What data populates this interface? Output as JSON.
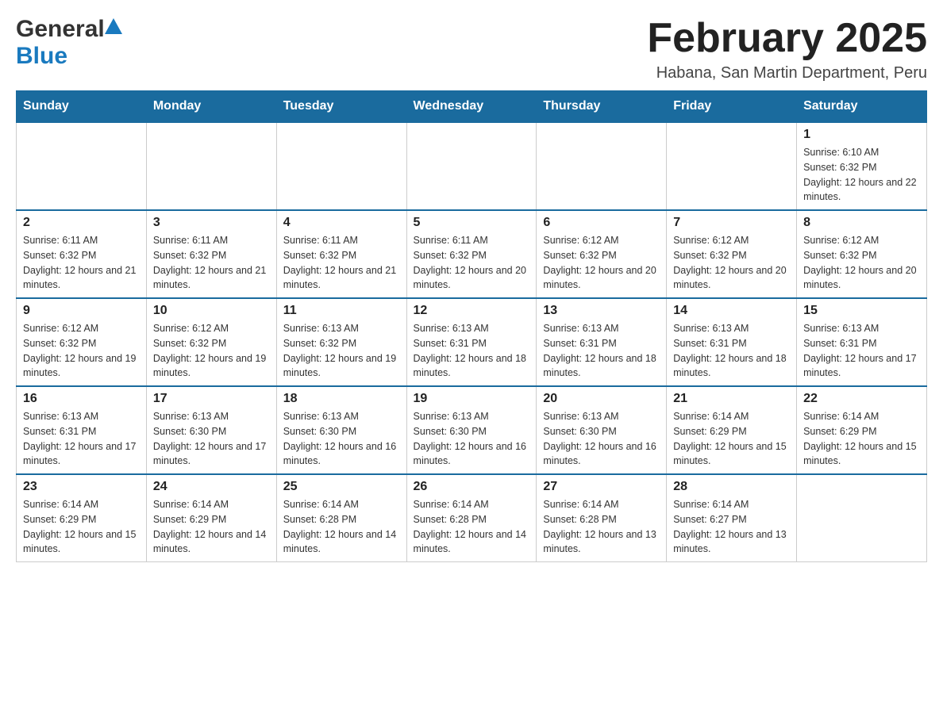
{
  "header": {
    "logo_general": "General",
    "logo_blue": "Blue",
    "month_year": "February 2025",
    "location": "Habana, San Martin Department, Peru"
  },
  "weekdays": [
    "Sunday",
    "Monday",
    "Tuesday",
    "Wednesday",
    "Thursday",
    "Friday",
    "Saturday"
  ],
  "weeks": [
    [
      {
        "day": "",
        "sunrise": "",
        "sunset": "",
        "daylight": ""
      },
      {
        "day": "",
        "sunrise": "",
        "sunset": "",
        "daylight": ""
      },
      {
        "day": "",
        "sunrise": "",
        "sunset": "",
        "daylight": ""
      },
      {
        "day": "",
        "sunrise": "",
        "sunset": "",
        "daylight": ""
      },
      {
        "day": "",
        "sunrise": "",
        "sunset": "",
        "daylight": ""
      },
      {
        "day": "",
        "sunrise": "",
        "sunset": "",
        "daylight": ""
      },
      {
        "day": "1",
        "sunrise": "Sunrise: 6:10 AM",
        "sunset": "Sunset: 6:32 PM",
        "daylight": "Daylight: 12 hours and 22 minutes."
      }
    ],
    [
      {
        "day": "2",
        "sunrise": "Sunrise: 6:11 AM",
        "sunset": "Sunset: 6:32 PM",
        "daylight": "Daylight: 12 hours and 21 minutes."
      },
      {
        "day": "3",
        "sunrise": "Sunrise: 6:11 AM",
        "sunset": "Sunset: 6:32 PM",
        "daylight": "Daylight: 12 hours and 21 minutes."
      },
      {
        "day": "4",
        "sunrise": "Sunrise: 6:11 AM",
        "sunset": "Sunset: 6:32 PM",
        "daylight": "Daylight: 12 hours and 21 minutes."
      },
      {
        "day": "5",
        "sunrise": "Sunrise: 6:11 AM",
        "sunset": "Sunset: 6:32 PM",
        "daylight": "Daylight: 12 hours and 20 minutes."
      },
      {
        "day": "6",
        "sunrise": "Sunrise: 6:12 AM",
        "sunset": "Sunset: 6:32 PM",
        "daylight": "Daylight: 12 hours and 20 minutes."
      },
      {
        "day": "7",
        "sunrise": "Sunrise: 6:12 AM",
        "sunset": "Sunset: 6:32 PM",
        "daylight": "Daylight: 12 hours and 20 minutes."
      },
      {
        "day": "8",
        "sunrise": "Sunrise: 6:12 AM",
        "sunset": "Sunset: 6:32 PM",
        "daylight": "Daylight: 12 hours and 20 minutes."
      }
    ],
    [
      {
        "day": "9",
        "sunrise": "Sunrise: 6:12 AM",
        "sunset": "Sunset: 6:32 PM",
        "daylight": "Daylight: 12 hours and 19 minutes."
      },
      {
        "day": "10",
        "sunrise": "Sunrise: 6:12 AM",
        "sunset": "Sunset: 6:32 PM",
        "daylight": "Daylight: 12 hours and 19 minutes."
      },
      {
        "day": "11",
        "sunrise": "Sunrise: 6:13 AM",
        "sunset": "Sunset: 6:32 PM",
        "daylight": "Daylight: 12 hours and 19 minutes."
      },
      {
        "day": "12",
        "sunrise": "Sunrise: 6:13 AM",
        "sunset": "Sunset: 6:31 PM",
        "daylight": "Daylight: 12 hours and 18 minutes."
      },
      {
        "day": "13",
        "sunrise": "Sunrise: 6:13 AM",
        "sunset": "Sunset: 6:31 PM",
        "daylight": "Daylight: 12 hours and 18 minutes."
      },
      {
        "day": "14",
        "sunrise": "Sunrise: 6:13 AM",
        "sunset": "Sunset: 6:31 PM",
        "daylight": "Daylight: 12 hours and 18 minutes."
      },
      {
        "day": "15",
        "sunrise": "Sunrise: 6:13 AM",
        "sunset": "Sunset: 6:31 PM",
        "daylight": "Daylight: 12 hours and 17 minutes."
      }
    ],
    [
      {
        "day": "16",
        "sunrise": "Sunrise: 6:13 AM",
        "sunset": "Sunset: 6:31 PM",
        "daylight": "Daylight: 12 hours and 17 minutes."
      },
      {
        "day": "17",
        "sunrise": "Sunrise: 6:13 AM",
        "sunset": "Sunset: 6:30 PM",
        "daylight": "Daylight: 12 hours and 17 minutes."
      },
      {
        "day": "18",
        "sunrise": "Sunrise: 6:13 AM",
        "sunset": "Sunset: 6:30 PM",
        "daylight": "Daylight: 12 hours and 16 minutes."
      },
      {
        "day": "19",
        "sunrise": "Sunrise: 6:13 AM",
        "sunset": "Sunset: 6:30 PM",
        "daylight": "Daylight: 12 hours and 16 minutes."
      },
      {
        "day": "20",
        "sunrise": "Sunrise: 6:13 AM",
        "sunset": "Sunset: 6:30 PM",
        "daylight": "Daylight: 12 hours and 16 minutes."
      },
      {
        "day": "21",
        "sunrise": "Sunrise: 6:14 AM",
        "sunset": "Sunset: 6:29 PM",
        "daylight": "Daylight: 12 hours and 15 minutes."
      },
      {
        "day": "22",
        "sunrise": "Sunrise: 6:14 AM",
        "sunset": "Sunset: 6:29 PM",
        "daylight": "Daylight: 12 hours and 15 minutes."
      }
    ],
    [
      {
        "day": "23",
        "sunrise": "Sunrise: 6:14 AM",
        "sunset": "Sunset: 6:29 PM",
        "daylight": "Daylight: 12 hours and 15 minutes."
      },
      {
        "day": "24",
        "sunrise": "Sunrise: 6:14 AM",
        "sunset": "Sunset: 6:29 PM",
        "daylight": "Daylight: 12 hours and 14 minutes."
      },
      {
        "day": "25",
        "sunrise": "Sunrise: 6:14 AM",
        "sunset": "Sunset: 6:28 PM",
        "daylight": "Daylight: 12 hours and 14 minutes."
      },
      {
        "day": "26",
        "sunrise": "Sunrise: 6:14 AM",
        "sunset": "Sunset: 6:28 PM",
        "daylight": "Daylight: 12 hours and 14 minutes."
      },
      {
        "day": "27",
        "sunrise": "Sunrise: 6:14 AM",
        "sunset": "Sunset: 6:28 PM",
        "daylight": "Daylight: 12 hours and 13 minutes."
      },
      {
        "day": "28",
        "sunrise": "Sunrise: 6:14 AM",
        "sunset": "Sunset: 6:27 PM",
        "daylight": "Daylight: 12 hours and 13 minutes."
      },
      {
        "day": "",
        "sunrise": "",
        "sunset": "",
        "daylight": ""
      }
    ]
  ]
}
